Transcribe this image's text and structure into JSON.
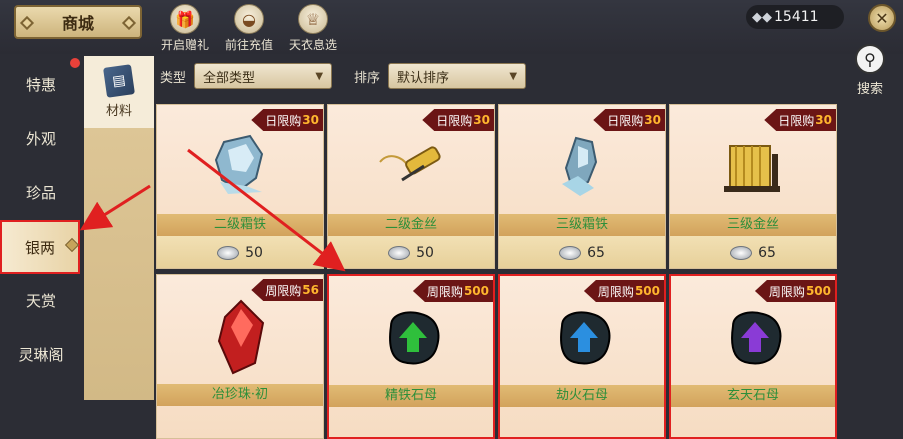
{
  "header": {
    "title": "商城",
    "buttons": [
      {
        "label": "开启赠礼",
        "icon": "gift-icon",
        "glyph": "🎁"
      },
      {
        "label": "前往充值",
        "icon": "gold-ingot-icon",
        "glyph": "◒"
      },
      {
        "label": "天衣息选",
        "icon": "robe-icon",
        "glyph": "♕"
      }
    ],
    "currency_value": "15411",
    "currency_icon": "silver-ingot-icon",
    "close_icon": "close-icon",
    "search_label": "搜索"
  },
  "sidebar": {
    "items": [
      {
        "label": "特惠"
      },
      {
        "label": "外观"
      },
      {
        "label": "珍品"
      },
      {
        "label": "银两",
        "active": true
      },
      {
        "label": "天赏"
      },
      {
        "label": "灵琳阁"
      }
    ]
  },
  "category": {
    "label": "材料",
    "icon": "book-icon"
  },
  "filters": {
    "type_label": "类型",
    "type_value": "全部类型",
    "sort_label": "排序",
    "sort_value": "默认排序"
  },
  "items": [
    {
      "limit_text": "日限购",
      "limit_num": "30",
      "name": "二级霜铁",
      "price": "50",
      "icon": "frost-iron-icon",
      "color": "#56a3d6",
      "highlight": false
    },
    {
      "limit_text": "日限购",
      "limit_num": "30",
      "name": "二级金丝",
      "price": "50",
      "icon": "gold-thread-icon",
      "color": "#d4a62a",
      "highlight": false
    },
    {
      "limit_text": "日限购",
      "limit_num": "30",
      "name": "三级霜铁",
      "price": "65",
      "icon": "frost-iron-icon",
      "color": "#56a3d6",
      "highlight": false
    },
    {
      "limit_text": "日限购",
      "limit_num": "30",
      "name": "三级金丝",
      "price": "65",
      "icon": "gold-thread-icon",
      "color": "#d4a62a",
      "highlight": false
    },
    {
      "limit_text": "周限购",
      "limit_num": "56",
      "name": "冶珍珠·初",
      "price": "",
      "icon": "red-crystal-icon",
      "color": "#b11b1b",
      "highlight": false
    },
    {
      "limit_text": "周限购",
      "limit_num": "500",
      "name": "精铁石母",
      "price": "",
      "icon": "green-arrow-stone-icon",
      "color": "#2fbf3c",
      "highlight": true
    },
    {
      "limit_text": "周限购",
      "limit_num": "500",
      "name": "劫火石母",
      "price": "",
      "icon": "blue-arrow-stone-icon",
      "color": "#2b8fe0",
      "highlight": true
    },
    {
      "limit_text": "周限购",
      "limit_num": "500",
      "name": "玄天石母",
      "price": "",
      "icon": "purple-arrow-stone-icon",
      "color": "#8a3bd6",
      "highlight": true
    }
  ],
  "colors": {
    "annotation_red": "#e02020",
    "limit_bg": "#6b1515",
    "limit_num": "#ffb62e",
    "name_green": "#2d8f3a"
  }
}
